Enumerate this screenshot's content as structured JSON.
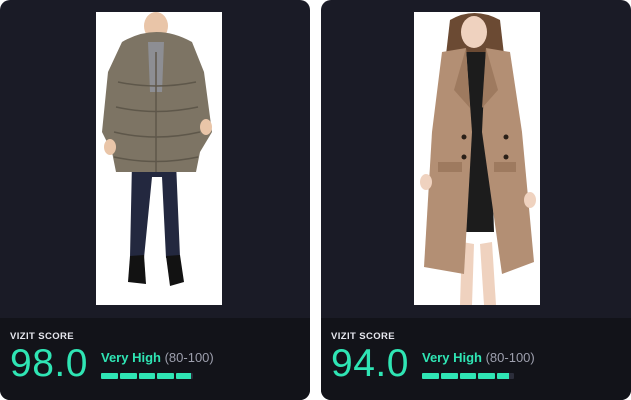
{
  "cards": [
    {
      "score_label": "VIZIT SCORE",
      "score": "98.0",
      "level": "Very High",
      "range": "(80-100)",
      "score_fraction": 0.98,
      "image_icon": "puffer-coat-photo"
    },
    {
      "score_label": "VIZIT SCORE",
      "score": "94.0",
      "level": "Very High",
      "range": "(80-100)",
      "score_fraction": 0.94,
      "image_icon": "wool-coat-photo"
    }
  ],
  "colors": {
    "accent": "#2fe5b4",
    "card_bg": "#1a1b26",
    "footer_bg": "#121319",
    "bar_track": "#2b2d3a",
    "range_text": "#9d9fad"
  }
}
